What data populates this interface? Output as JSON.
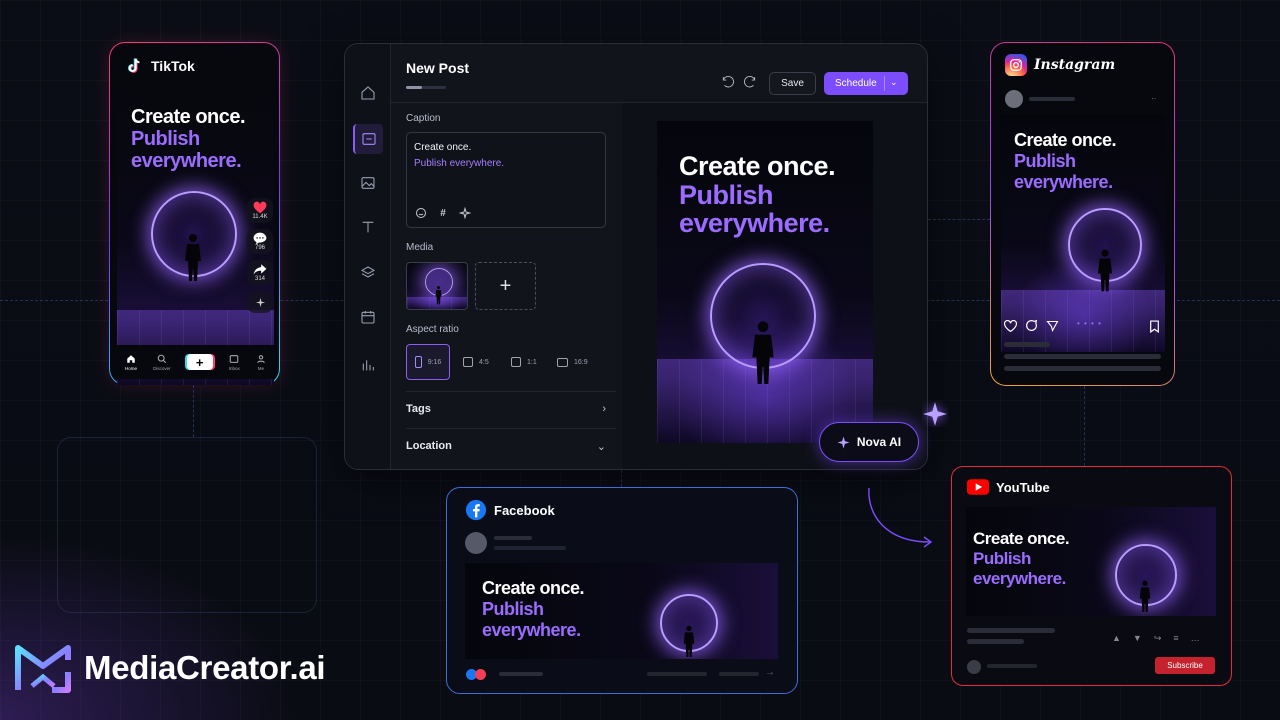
{
  "brand": {
    "name": "MediaCreator.ai"
  },
  "artwork": {
    "line1": "Create once.",
    "line2": "Publish",
    "line3": "everywhere."
  },
  "tiktok": {
    "name": "TikTok",
    "likes": "11.4K",
    "comments": "796",
    "shares": "314",
    "nav": [
      "Home",
      "Discover",
      "+",
      "Inbox",
      "Me"
    ]
  },
  "instagram": {
    "name": "Instagram"
  },
  "facebook": {
    "name": "Facebook"
  },
  "youtube": {
    "name": "YouTube",
    "subscribe": "Subscribe"
  },
  "editor": {
    "title": "New Post",
    "progress": 0.4,
    "save": "Save",
    "schedule": "Schedule",
    "caption_label": "Caption",
    "caption_line1": "Create once.",
    "caption_line2": "Publish everywhere.",
    "media_label": "Media",
    "aspect_label": "Aspect ratio",
    "ratios": [
      "9:16",
      "4:5",
      "1:1",
      "16:9"
    ],
    "tags": "Tags",
    "location": "Location"
  },
  "nova": {
    "label": "Nova AI"
  },
  "colors": {
    "accent": "#7c4dff",
    "purple_text": "#9b6cff",
    "facebook": "#3e6ed8",
    "youtube": "#e12d39"
  }
}
